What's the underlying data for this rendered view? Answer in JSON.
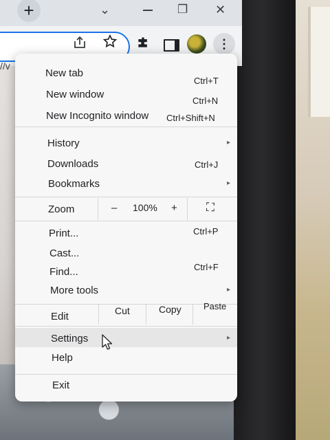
{
  "browser": {
    "tab_strip": {
      "new_tab_symbol": "+",
      "search_tabs_symbol": "⌄",
      "restore_symbol": "❐",
      "close_symbol": "✕"
    },
    "toolbar": {
      "url_fragment": "//v",
      "more_symbol": "⋮"
    }
  },
  "menu": {
    "items": [
      {
        "label": "New tab",
        "shortcut": "Ctrl+T"
      },
      {
        "label": "New window",
        "shortcut": "Ctrl+N"
      },
      {
        "label": "New Incognito window",
        "shortcut": "Ctrl+Shift+N"
      },
      {
        "label": "History",
        "has_submenu": true
      },
      {
        "label": "Downloads",
        "shortcut": "Ctrl+J"
      },
      {
        "label": "Bookmarks",
        "has_submenu": true
      },
      {
        "label": "Print...",
        "shortcut": "Ctrl+P"
      },
      {
        "label": "Cast..."
      },
      {
        "label": "Find...",
        "shortcut": "Ctrl+F"
      },
      {
        "label": "More tools",
        "has_submenu": true
      },
      {
        "label": "Settings",
        "has_submenu": true,
        "hovered": true
      },
      {
        "label": "Help"
      },
      {
        "label": "Exit"
      }
    ],
    "zoom": {
      "label": "Zoom",
      "minus": "–",
      "level": "100%",
      "plus": "+",
      "fullscreen_symbol": "⛶"
    },
    "edit": {
      "label": "Edit",
      "cut": "Cut",
      "copy": "Copy",
      "paste": "Paste"
    },
    "submenu_arrow": "▸"
  },
  "colors": {
    "accent": "#1a73e8",
    "menu_bg": "#f7f7f7",
    "hover_bg": "#e6e6e6"
  }
}
